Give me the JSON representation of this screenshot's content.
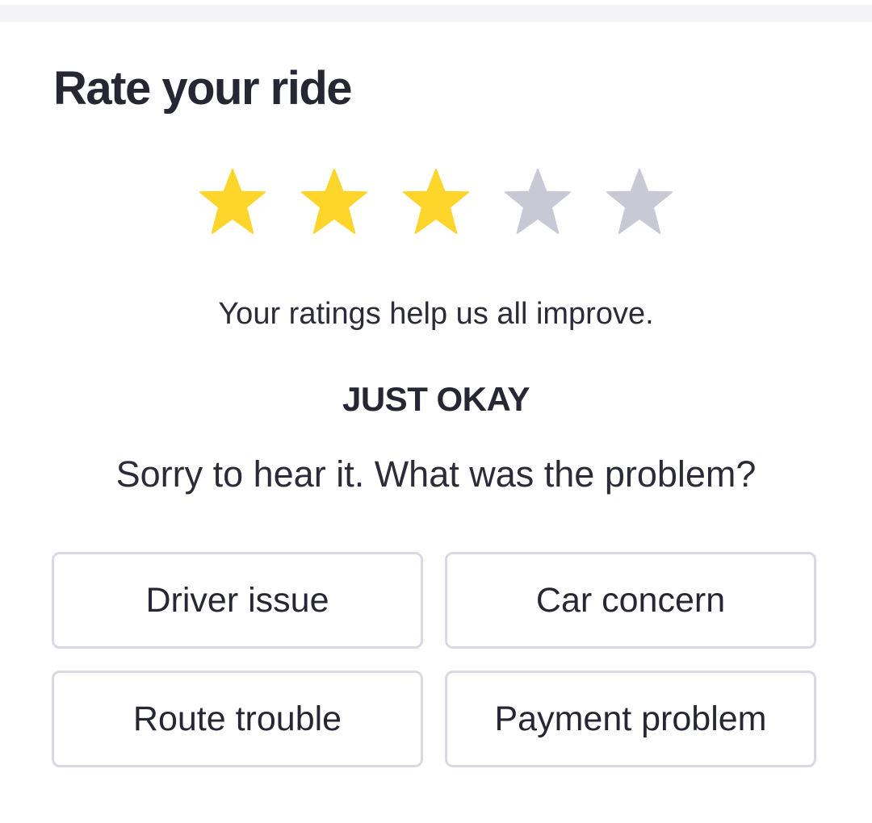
{
  "title": "Rate your ride",
  "rating": {
    "value": 3,
    "max": 5,
    "filled_color": "#FDD52B",
    "empty_color": "#C9C9D6",
    "icon": "star-icon"
  },
  "help_text": "Your ratings help us all improve.",
  "rating_label": "JUST OKAY",
  "problem_question": "Sorry to hear it. What was the problem?",
  "options": [
    {
      "label": "Driver issue"
    },
    {
      "label": "Car concern"
    },
    {
      "label": "Route trouble"
    },
    {
      "label": "Payment problem"
    }
  ]
}
